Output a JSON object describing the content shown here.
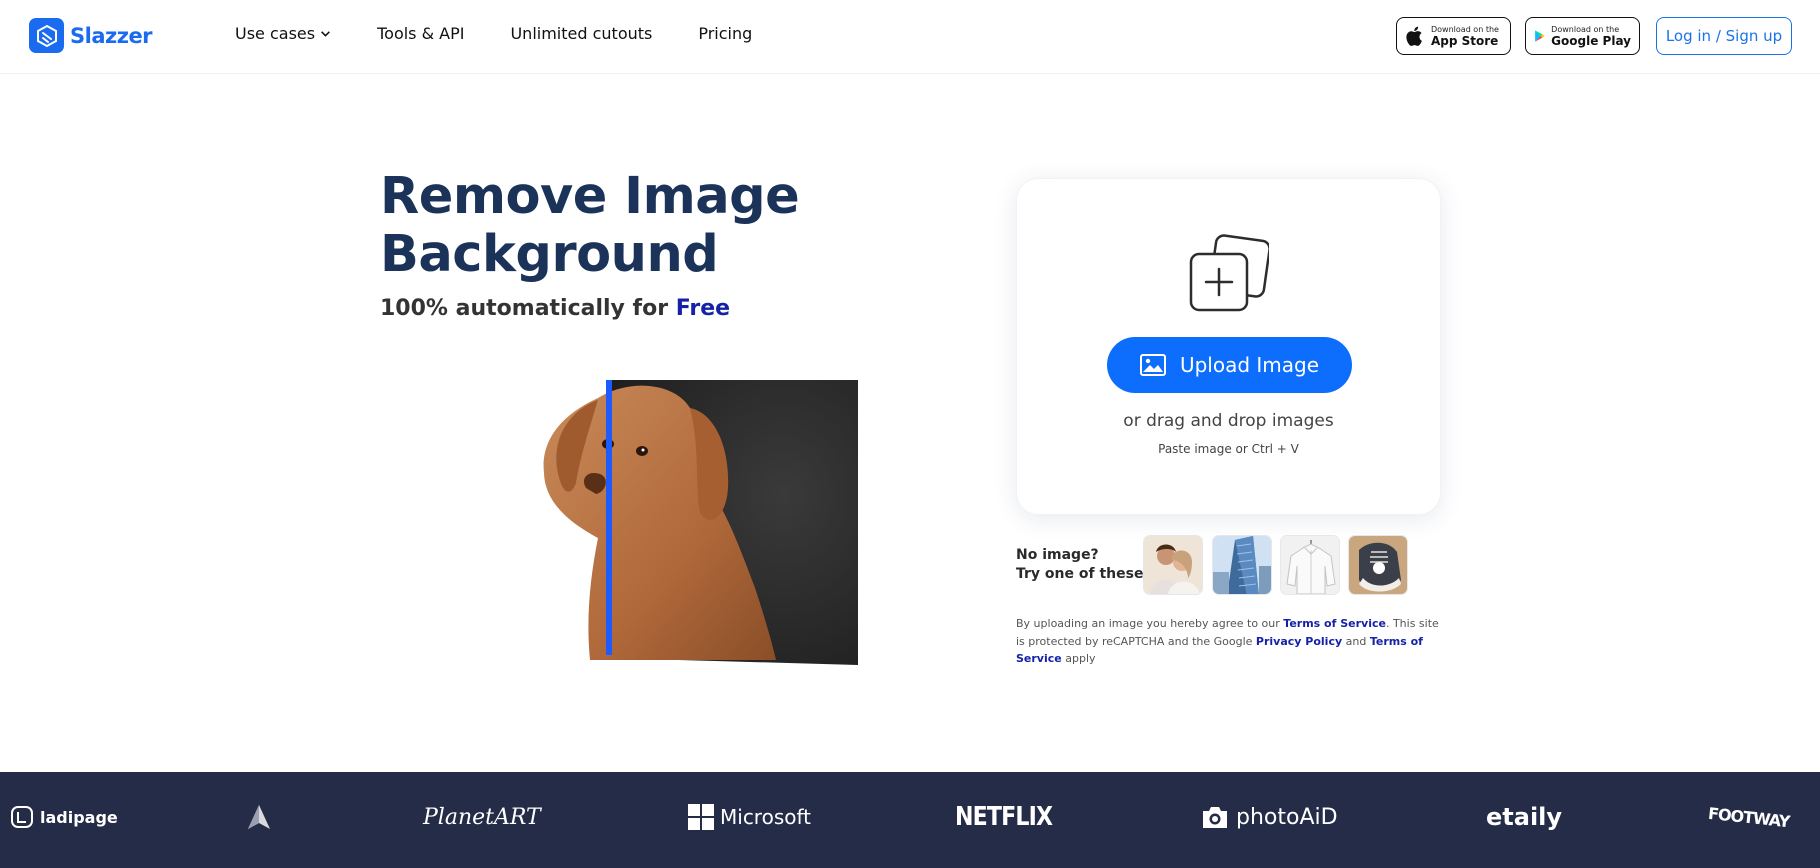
{
  "header": {
    "logo_text": "Slazzer",
    "nav": [
      {
        "label": "Use cases",
        "has_dropdown": true
      },
      {
        "label": "Tools & API"
      },
      {
        "label": "Unlimited cutouts"
      },
      {
        "label": "Pricing"
      }
    ],
    "app_store": {
      "small": "Download on the",
      "big": "App Store"
    },
    "google_play": {
      "small": "Download on the",
      "big": "Google Play"
    },
    "login_label": "Log in / Sign up"
  },
  "hero": {
    "title": "Remove Image Background",
    "subtitle_prefix": "100% automatically for",
    "subtitle_highlight": "Free"
  },
  "upload": {
    "button_label": "Upload Image",
    "drag_text": "or drag and drop images",
    "paste_text": "Paste image or Ctrl + V"
  },
  "samples": {
    "label_line1": "No image?",
    "label_line2": "Try one of these:"
  },
  "legal": {
    "t1": "By uploading an image you hereby agree to our",
    "link1": "Terms of Service",
    "t2": ". This site is protected by reCAPTCHA and the Google",
    "link2": "Privacy Policy",
    "t3": "and",
    "link3": "Terms of Service",
    "t4": "apply"
  },
  "brands": [
    "ladipage",
    "PlanetART",
    "Microsoft",
    "NETFLIX",
    "photoAiD",
    "etaily",
    "FOOTWAY"
  ],
  "colors": {
    "brand": "#1a6bf0",
    "title": "#1c3359",
    "free": "#1522a8",
    "upload_button": "#0d6efd",
    "brands_bg": "#252c47"
  }
}
